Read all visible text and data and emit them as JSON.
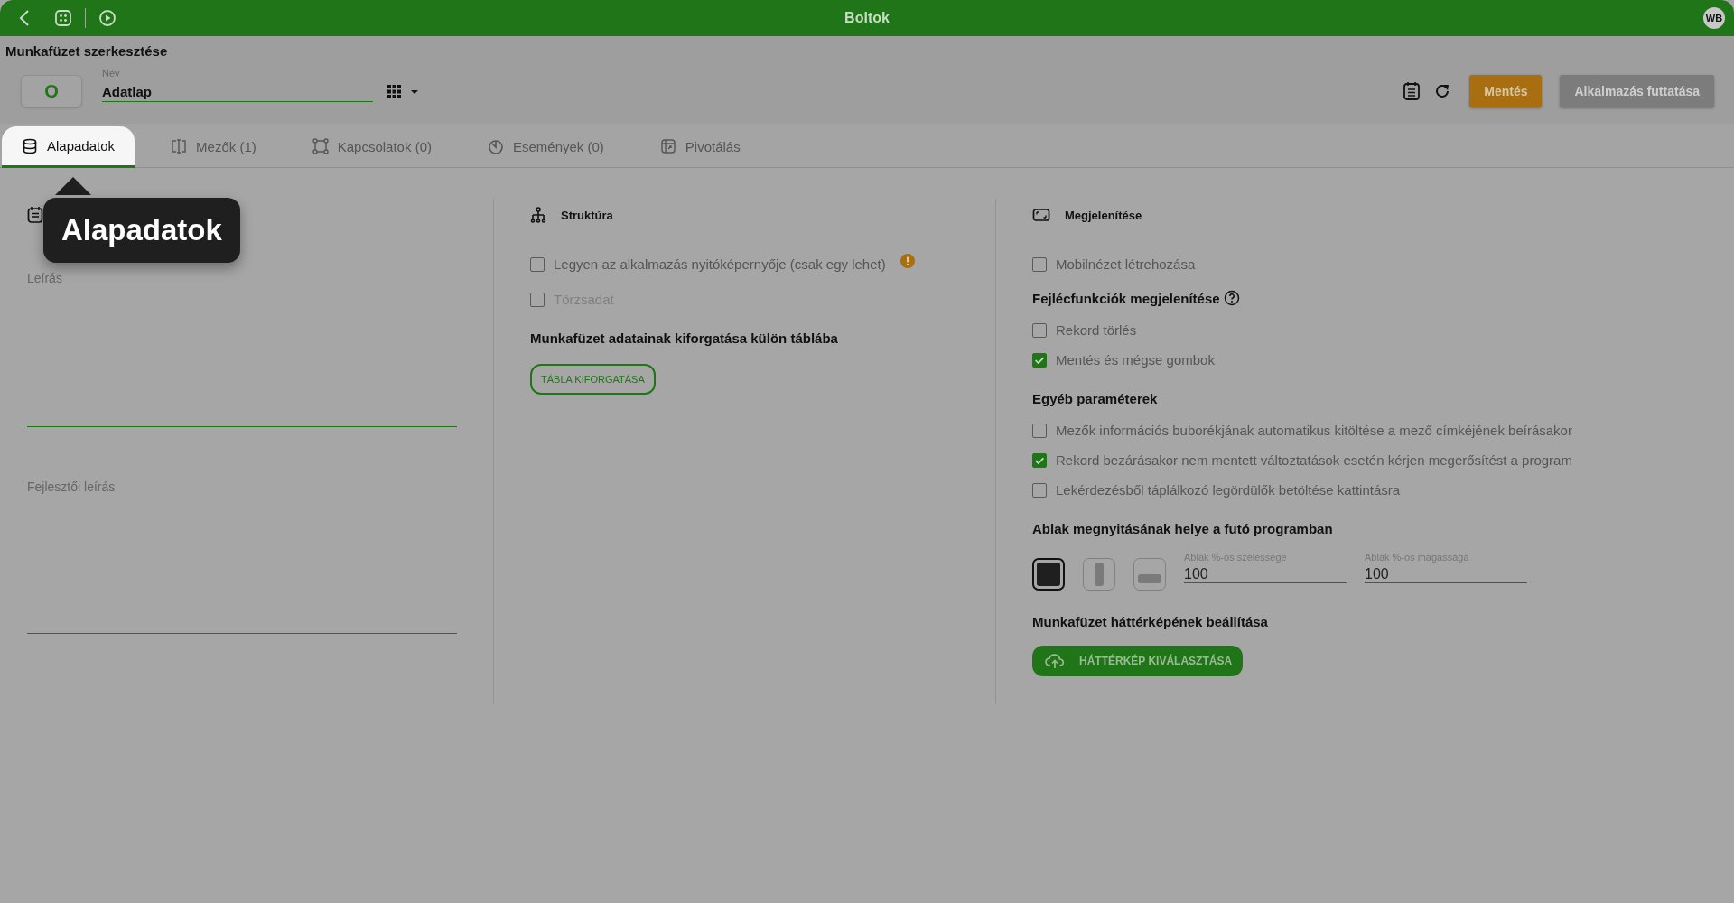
{
  "app_bar": {
    "title": "Boltok",
    "avatar": "WB"
  },
  "page_title": "Munkafüzet szerkesztése",
  "toolbar": {
    "icon_button": "O",
    "name_field": {
      "label": "Név",
      "value": "Adatlap"
    },
    "buttons": [
      {
        "label": "Mentés",
        "kind": "primary"
      },
      {
        "label": "Alkalmazás futtatása",
        "kind": "disabled"
      }
    ]
  },
  "tabs": [
    {
      "label": "Alapadatok",
      "selected": true
    },
    {
      "label": "Mezők (1)",
      "selected": false
    },
    {
      "label": "Kapcsolatok (0)",
      "selected": false
    },
    {
      "label": "Események (0)",
      "selected": false
    },
    {
      "label": "Pivotálás",
      "selected": false
    }
  ],
  "tooltip": {
    "text": "Alapadatok"
  },
  "basic": {
    "fields": [
      {
        "label": "Leírás"
      },
      {
        "label": "Fejlesztői leírás"
      }
    ]
  },
  "structure": {
    "title": "Struktúra",
    "options": [
      {
        "label": "Legyen az alkalmazás nyitóképernyője (csak egy lehet)",
        "checked": false,
        "disabled": false,
        "warning": true
      },
      {
        "label": "Törzsadat",
        "checked": false,
        "disabled": true,
        "warning": false
      }
    ],
    "pivot": {
      "title": "Munkafüzet adatainak kiforgatása külön táblába",
      "button": "TÁBLA KIFORGATÁSA"
    }
  },
  "display": {
    "title": "Megjelenítése",
    "mobile": {
      "label": "Mobilnézet létrehozása",
      "checked": false
    },
    "header_functions": {
      "title": "Fejlécfunkciók megjelenítése",
      "options": [
        {
          "label": "Rekord törlés",
          "checked": false
        },
        {
          "label": "Mentés és mégse gombok",
          "checked": true
        }
      ]
    },
    "other": {
      "title": "Egyéb paraméterek",
      "options": [
        {
          "label": "Mezők információs buborékjának automatikus kitöltése a mező címkéjének beírásakor",
          "checked": false
        },
        {
          "label": "Rekord bezárásakor nem mentett változtatások esetén kérjen megerősítést a program",
          "checked": true
        },
        {
          "label": "Lekérdezésből táplálkozó legördülők betöltése kattintásra",
          "checked": false
        }
      ]
    },
    "window": {
      "title": "Ablak megnyitásának helye a futó programban",
      "positions": [
        {
          "selected": true
        },
        {
          "selected": false
        },
        {
          "selected": false
        }
      ],
      "width": {
        "label": "Ablak %-os szélessége",
        "value": "100"
      },
      "height": {
        "label": "Ablak %-os magassága",
        "value": "100"
      }
    },
    "background": {
      "title": "Munkafüzet háttérképének beállítása",
      "button": "HÁTTÉRKÉP KIVÁLASZTÁSA"
    }
  }
}
